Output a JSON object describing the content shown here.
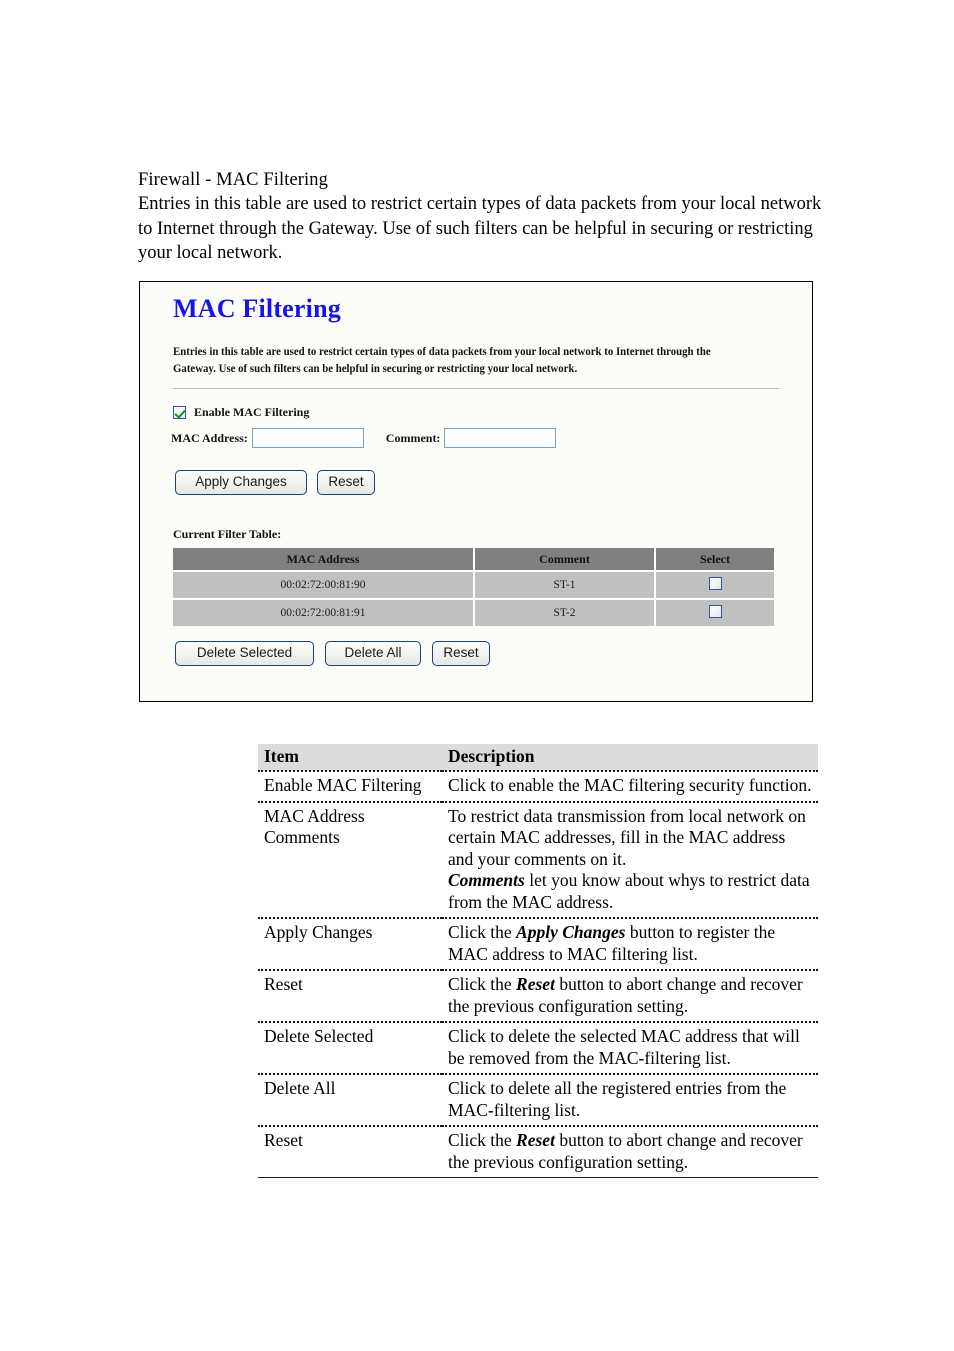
{
  "intro": {
    "title": "Firewall - MAC Filtering",
    "body": "Entries in this table are used to restrict certain types of data packets from your local network to Internet through the Gateway. Use of such filters can be helpful in securing or restricting your local network."
  },
  "panel": {
    "title": "MAC Filtering",
    "title_color": "#1712f0",
    "description": "Entries in this table are used to restrict certain types of data packets from your local network to Internet through the Gateway. Use of such filters can be helpful in securing or restricting your local network.",
    "enable": {
      "label": "Enable MAC Filtering",
      "checked": true,
      "check_color": "#0f9123"
    },
    "form": {
      "mac_label": "MAC Address:",
      "mac_value": "",
      "mac_placeholder": "",
      "comment_label": "Comment:",
      "comment_value": "",
      "comment_placeholder": ""
    },
    "buttons_top": {
      "apply": "Apply Changes",
      "reset": "Reset"
    },
    "filter_table": {
      "caption": "Current Filter Table:",
      "headers": [
        "MAC Address",
        "Comment",
        "Select"
      ],
      "rows": [
        {
          "mac": "00:02:72:00:81:90",
          "comment": "ST-1",
          "selected": false
        },
        {
          "mac": "00:02:72:00:81:91",
          "comment": "ST-2",
          "selected": false
        }
      ],
      "header_bg": "#808080",
      "row_bg": "#c0c0c0"
    },
    "buttons_bottom": {
      "delete_selected": "Delete Selected",
      "delete_all": "Delete All",
      "reset": "Reset"
    }
  },
  "desc_table": {
    "headers": [
      "Item",
      "Description"
    ],
    "rows": [
      {
        "item": "Enable MAC Filtering",
        "desc_parts": [
          {
            "text": "Click to enable the MAC filtering security function.",
            "style": "normal"
          }
        ]
      },
      {
        "item": "MAC Address Comments",
        "desc_parts": [
          {
            "text": "To restrict data transmission from local network on certain MAC addresses, fill in the MAC address and your comments on it.",
            "style": "normal"
          },
          {
            "text": "break",
            "style": "break"
          },
          {
            "text": "Comments",
            "style": "bold-italic"
          },
          {
            "text": " let you know about whys to restrict data from the MAC address.",
            "style": "normal"
          }
        ]
      },
      {
        "item": "Apply Changes",
        "desc_parts": [
          {
            "text": "Click the ",
            "style": "normal"
          },
          {
            "text": "Apply Changes",
            "style": "bold-italic"
          },
          {
            "text": " button to register the MAC address to MAC filtering list.",
            "style": "normal"
          }
        ]
      },
      {
        "item": "Reset",
        "desc_parts": [
          {
            "text": "Click the ",
            "style": "normal"
          },
          {
            "text": "Reset",
            "style": "bold-italic"
          },
          {
            "text": " button to abort change and recover the previous configuration setting.",
            "style": "normal"
          }
        ]
      },
      {
        "item": "Delete Selected",
        "desc_parts": [
          {
            "text": "Click to delete the selected MAC address that will be removed from the MAC-filtering list.",
            "style": "normal"
          }
        ]
      },
      {
        "item": "Delete All",
        "desc_parts": [
          {
            "text": "Click to delete all the registered entries from the MAC-filtering list.",
            "style": "normal"
          }
        ]
      },
      {
        "item": "Reset",
        "desc_parts": [
          {
            "text": "Click the ",
            "style": "normal"
          },
          {
            "text": "Reset",
            "style": "bold-italic"
          },
          {
            "text": " button to abort change and recover the previous configuration setting.",
            "style": "normal"
          }
        ]
      }
    ]
  }
}
